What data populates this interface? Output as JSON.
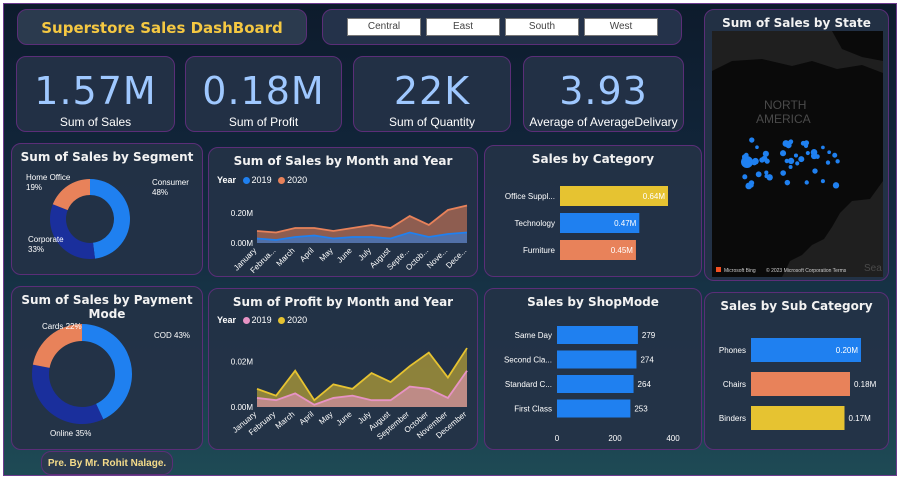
{
  "header": {
    "title": "Superstore Sales DashBoard"
  },
  "slicer": {
    "regions": [
      "Central",
      "East",
      "South",
      "West"
    ]
  },
  "kpis": [
    {
      "value": "1.57M",
      "label": "Sum of Sales"
    },
    {
      "value": "0.18M",
      "label": "Sum of Profit"
    },
    {
      "value": "22K",
      "label": "Sum of Quantity"
    },
    {
      "value": "3.93",
      "label": "Average of AverageDelivary"
    }
  ],
  "map": {
    "title": "Sum of Sales by State",
    "label_north": "NORTH",
    "label_america": "AMERICA",
    "label_sea": "Sea",
    "copyright": "© 2023 Microsoft Corporation  Terms",
    "bing": "Microsoft Bing"
  },
  "footer": {
    "credit": "Pre. By Mr. Rohit Nalage."
  },
  "colors": {
    "blue": "#1f80f0",
    "orange": "#e8825a",
    "navy": "#1a2f9c",
    "yellow": "#e6c331",
    "pink": "#e793c4",
    "olive": "#9a9434"
  },
  "chart_data": [
    {
      "type": "pie",
      "title": "Sum of Sales by Segment",
      "categories": [
        "Consumer",
        "Corporate",
        "Home Office"
      ],
      "values": [
        48,
        33,
        19
      ],
      "labels": [
        "Consumer\n48%",
        "Corporate\n33%",
        "Home Office\n19%"
      ],
      "colors": [
        "#1f80f0",
        "#1a2f9c",
        "#e8825a"
      ]
    },
    {
      "type": "pie",
      "title": "Sum of Sales by Payment Mode",
      "categories": [
        "COD",
        "Online",
        "Cards"
      ],
      "values": [
        43,
        35,
        22
      ],
      "labels": [
        "COD 43%",
        "Online 35%",
        "Cards 22%"
      ],
      "colors": [
        "#1f80f0",
        "#1a2f9c",
        "#e8825a"
      ]
    },
    {
      "type": "area",
      "title": "Sum of Sales by Month and Year",
      "legend_title": "Year",
      "categories": [
        "January",
        "Februa...",
        "March",
        "April",
        "May",
        "June",
        "July",
        "August",
        "Septe...",
        "Octob...",
        "Nove...",
        "Dece..."
      ],
      "series": [
        {
          "name": "2019",
          "values": [
            0.03,
            0.02,
            0.04,
            0.05,
            0.03,
            0.04,
            0.04,
            0.03,
            0.07,
            0.04,
            0.06,
            0.07
          ],
          "color": "#1f80f0"
        },
        {
          "name": "2020",
          "values": [
            0.08,
            0.07,
            0.1,
            0.1,
            0.08,
            0.1,
            0.12,
            0.1,
            0.18,
            0.12,
            0.22,
            0.25
          ],
          "color": "#e8825a"
        }
      ],
      "yticks": [
        "0.00M",
        "0.20M"
      ],
      "ylim": [
        0,
        0.3
      ]
    },
    {
      "type": "area",
      "title": "Sum of Profit by Month and Year",
      "legend_title": "Year",
      "categories": [
        "January",
        "February",
        "March",
        "April",
        "May",
        "June",
        "July",
        "August",
        "September",
        "October",
        "November",
        "December"
      ],
      "series": [
        {
          "name": "2019",
          "values": [
            0.004,
            0.003,
            0.006,
            0.001,
            0.004,
            0.005,
            0.003,
            0.003,
            0.009,
            0.008,
            0.004,
            0.016
          ],
          "color": "#e793c4"
        },
        {
          "name": "2020",
          "values": [
            0.008,
            0.005,
            0.016,
            0.003,
            0.01,
            0.008,
            0.015,
            0.011,
            0.018,
            0.024,
            0.013,
            0.026
          ],
          "color": "#e6c331"
        }
      ],
      "yticks": [
        "0.00M",
        "0.02M"
      ],
      "ylim": [
        0,
        0.03
      ]
    },
    {
      "type": "bar",
      "title": "Sales by Category",
      "categories": [
        "Office Suppl...",
        "Technology",
        "Furniture"
      ],
      "values": [
        0.64,
        0.47,
        0.45
      ],
      "value_labels": [
        "0.64M",
        "0.47M",
        "0.45M"
      ],
      "colors": [
        "#e6c331",
        "#1f80f0",
        "#e8825a"
      ]
    },
    {
      "type": "bar",
      "title": "Sales by ShopMode",
      "categories": [
        "Same Day",
        "Second Cla...",
        "Standard C...",
        "First Class"
      ],
      "values": [
        279,
        274,
        264,
        253
      ],
      "xticks": [
        "0",
        "200",
        "400"
      ],
      "xlim": [
        0,
        400
      ],
      "colors": [
        "#1f80f0"
      ]
    },
    {
      "type": "bar",
      "title": "Sales by Sub Category",
      "categories": [
        "Phones",
        "Chairs",
        "Binders"
      ],
      "values": [
        0.2,
        0.18,
        0.17
      ],
      "value_labels": [
        "0.20M",
        "0.18M",
        "0.17M"
      ],
      "colors": [
        "#1f80f0",
        "#e8825a",
        "#e6c331"
      ]
    }
  ]
}
